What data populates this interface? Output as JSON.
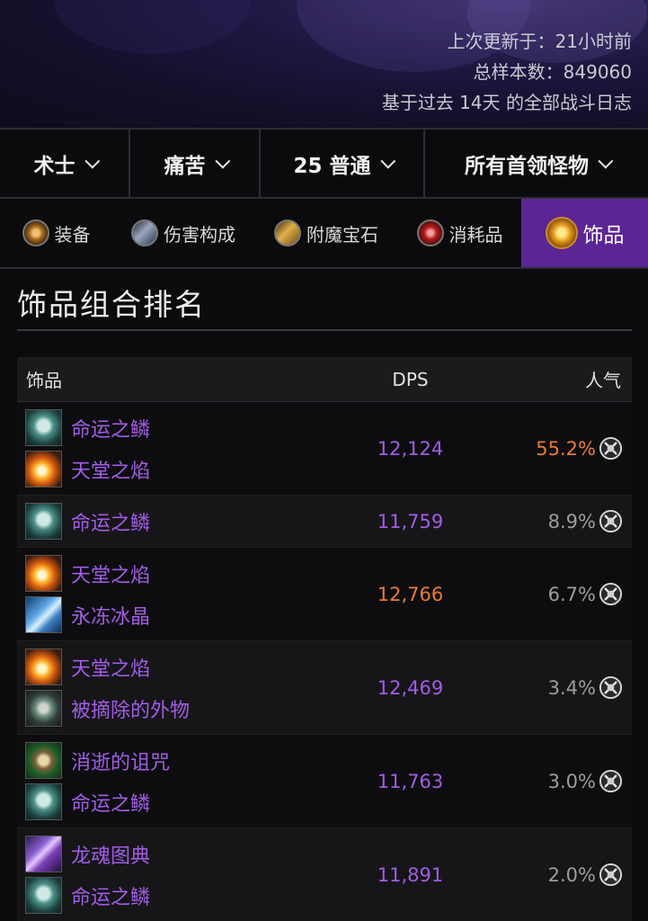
{
  "meta": {
    "last_updated": "上次更新于：21小时前",
    "sample_total": "总样本数：849060",
    "based_on": "基于过去 14天 的全部战斗日志"
  },
  "filters": [
    {
      "label": "术士"
    },
    {
      "label": "痛苦"
    },
    {
      "label": "25 普通"
    },
    {
      "label": "所有首领怪物"
    }
  ],
  "tabs": [
    {
      "label": "装备",
      "icon": "gear-icon",
      "active": false
    },
    {
      "label": "伤害构成",
      "icon": "damage-breakdown-icon",
      "active": false
    },
    {
      "label": "附魔宝石",
      "icon": "enchant-gem-icon",
      "active": false
    },
    {
      "label": "消耗品",
      "icon": "consumable-icon",
      "active": false
    },
    {
      "label": "饰品",
      "icon": "trinket-icon",
      "active": true
    }
  ],
  "section_title": "饰品组合排名",
  "table": {
    "headers": {
      "trinket": "饰品",
      "dps": "DPS",
      "popularity": "人气"
    },
    "rows": [
      {
        "items": [
          {
            "name": "命运之鳞",
            "icon": "scale-of-fates-icon"
          },
          {
            "name": "天堂之焰",
            "icon": "flame-of-heavens-icon"
          }
        ],
        "dps": "12,124",
        "popularity": "55.2%",
        "dps_color": "#a25ce6",
        "pop_color": "#ec7a33"
      },
      {
        "items": [
          {
            "name": "命运之鳞",
            "icon": "scale-of-fates-icon"
          }
        ],
        "dps": "11,759",
        "popularity": "8.9%",
        "dps_color": "#a25ce6",
        "pop_color": "#9d9d9d"
      },
      {
        "items": [
          {
            "name": "天堂之焰",
            "icon": "flame-of-heavens-icon"
          },
          {
            "name": "永冻冰晶",
            "icon": "eternal-ice-crystal-icon"
          }
        ],
        "dps": "12,766",
        "popularity": "6.7%",
        "dps_color": "#ec7a33",
        "pop_color": "#9d9d9d"
      },
      {
        "items": [
          {
            "name": "天堂之焰",
            "icon": "flame-of-heavens-icon"
          },
          {
            "name": "被摘除的外物",
            "icon": "extracted-relic-icon"
          }
        ],
        "dps": "12,469",
        "popularity": "3.4%",
        "dps_color": "#a25ce6",
        "pop_color": "#9d9d9d"
      },
      {
        "items": [
          {
            "name": "消逝的诅咒",
            "icon": "fading-curse-icon"
          },
          {
            "name": "命运之鳞",
            "icon": "scale-of-fates-icon"
          }
        ],
        "dps": "11,763",
        "popularity": "3.0%",
        "dps_color": "#a25ce6",
        "pop_color": "#9d9d9d"
      },
      {
        "items": [
          {
            "name": "龙魂图典",
            "icon": "dragon-soul-tome-icon"
          },
          {
            "name": "命运之鳞",
            "icon": "scale-of-fates-icon"
          }
        ],
        "dps": "11,891",
        "popularity": "2.0%",
        "dps_color": "#a25ce6",
        "pop_color": "#9d9d9d"
      }
    ]
  }
}
